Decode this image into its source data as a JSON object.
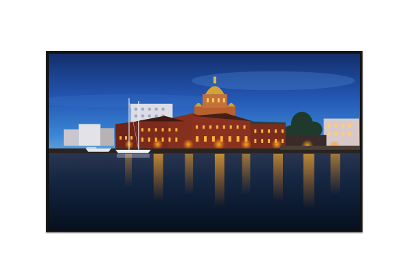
{
  "product": {
    "type": "display panel",
    "bezel_color": "#111111",
    "background_color": "#ffffff"
  },
  "screen_image": {
    "subject": "harbour-at-dusk-photo",
    "palette": {
      "sky_top": "#1a3f8c",
      "sky_mid": "#2d63c4",
      "sky_horizon": "#3b86d6",
      "water": "#0b1c33",
      "brick": "#7c2a1b",
      "light": "#ffb02a",
      "dome_gold": "#d4a23a"
    }
  }
}
